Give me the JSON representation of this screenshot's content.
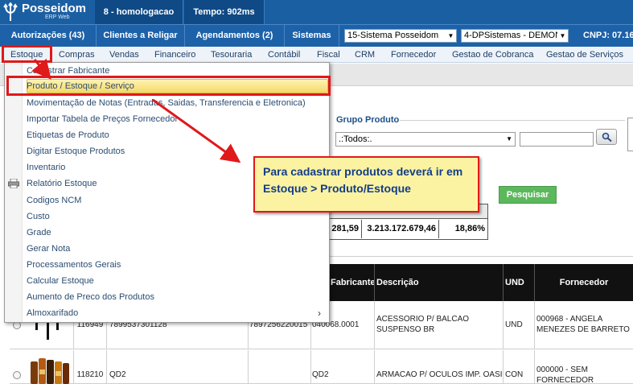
{
  "app": {
    "logo_title": "Posseidom",
    "logo_subtitle": "ERP Web",
    "environment": "8 - homologacao",
    "time": "Tempo: 902ms"
  },
  "navbar2": {
    "items": [
      "Autorizações (43)",
      "Clientes a Religar",
      "Agendamentos (2)",
      "Sistemas"
    ],
    "system_select": "15-Sistema Posseidom",
    "company_select": "4-DPSistemas - DEMON",
    "cnpj": "CNPJ: 07.164"
  },
  "menu": {
    "items": [
      "Estoque",
      "Compras",
      "Vendas",
      "Financeiro",
      "Tesouraria",
      "Contábil",
      "Fiscal",
      "CRM",
      "Fornecedor",
      "Gestao de Cobranca",
      "Gestao de Serviços"
    ]
  },
  "dropdown": {
    "items": [
      "Cadastrar Fabricante",
      "Produto / Estoque / Serviço",
      "Movimentação de Notas (Entradas, Saidas, Transferencia e Eletronica)",
      "Importar Tabela de Preços Fornecedor",
      "Etiquetas de Produto",
      "Digitar Estoque Produtos",
      "Inventario",
      "Relatório Estoque",
      "Codigos NCM",
      "Custo",
      "Grade",
      "Gerar Nota",
      "Processamentos Gerais",
      "Calcular Estoque",
      "Aumento de Preco dos Produtos",
      "Almoxarifado"
    ],
    "submenu_arrow": "›"
  },
  "callout": {
    "text": "Para cadastrar produtos deverá ir em Estoque > Produto/Estoque"
  },
  "filter": {
    "group_label": "Grupo Produto",
    "group_select": ".:Todos:.",
    "search_button": "Pesquisar"
  },
  "totals": {
    "values": [
      "281,59",
      "3.213.172.679,46",
      "18,86%"
    ]
  },
  "table": {
    "headers": [
      "Fabricante",
      "Descrição",
      "UND",
      "Fornecedor"
    ],
    "rows": [
      {
        "id": "116949",
        "code": "7899537301128",
        "barcode": "7897256220015",
        "fabricante": "040068.0001",
        "descricao": "ACESSORIO P/ BALCAO SUSPENSO BR",
        "und": "UND",
        "fornecedor": "000968 - ANGELA MENEZES DE BARRETO"
      },
      {
        "id": "118210",
        "code": "QD2",
        "barcode": "",
        "fabricante": "QD2",
        "descricao": "ARMACAO P/ OCULOS IMP. OASI",
        "und": "CON",
        "fornecedor": "000000 - SEM FORNECEDOR"
      }
    ]
  },
  "colors": {
    "brand_blue": "#1b5fa3",
    "highlight_red": "#e0191a",
    "callout_yellow": "#fcf3a2",
    "search_green": "#5cb85c"
  }
}
